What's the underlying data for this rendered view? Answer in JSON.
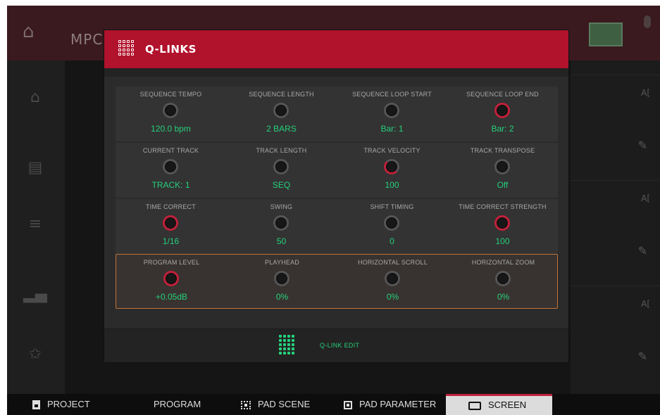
{
  "background_app": {
    "title": "MPC"
  },
  "modal": {
    "title": "Q-LINKS",
    "rows": [
      {
        "cells": [
          {
            "label": "SEQUENCE TEMPO",
            "value": "120.0 bpm"
          },
          {
            "label": "SEQUENCE LENGTH",
            "value": "2 BARS"
          },
          {
            "label": "SEQUENCE LOOP START",
            "value": "Bar: 1"
          },
          {
            "label": "SEQUENCE LOOP END",
            "value": "Bar: 2"
          }
        ]
      },
      {
        "cells": [
          {
            "label": "CURRENT TRACK",
            "value": "TRACK: 1"
          },
          {
            "label": "TRACK LENGTH",
            "value": "SEQ"
          },
          {
            "label": "TRACK VELOCITY",
            "value": "100"
          },
          {
            "label": "TRACK TRANSPOSE",
            "value": "Off"
          }
        ]
      },
      {
        "cells": [
          {
            "label": "TIME CORRECT",
            "value": "1/16"
          },
          {
            "label": "SWING",
            "value": "50"
          },
          {
            "label": "SHIFT TIMING",
            "value": "0"
          },
          {
            "label": "TIME CORRECT STRENGTH",
            "value": "100"
          }
        ]
      },
      {
        "cells": [
          {
            "label": "PROGRAM LEVEL",
            "value": "+0.05dB"
          },
          {
            "label": "PLAYHEAD",
            "value": "0%"
          },
          {
            "label": "HORIZONTAL SCROLL",
            "value": "0%"
          },
          {
            "label": "HORIZONTAL ZOOM",
            "value": "0%"
          }
        ]
      }
    ],
    "footer_label": "Q-LINK EDIT"
  },
  "tabs": [
    {
      "label": "PROJECT",
      "icon": "project-icon"
    },
    {
      "label": "PROGRAM",
      "icon": "program-icon"
    },
    {
      "label": "PAD SCENE",
      "icon": "pad-scene-icon"
    },
    {
      "label": "PAD PARAMETER",
      "icon": "pad-parameter-icon"
    },
    {
      "label": "SCREEN",
      "icon": "screen-icon",
      "active": true
    }
  ],
  "colors": {
    "accent_red": "#b1122c",
    "value_green": "#25d07b",
    "active_row_border": "#c0743a"
  }
}
